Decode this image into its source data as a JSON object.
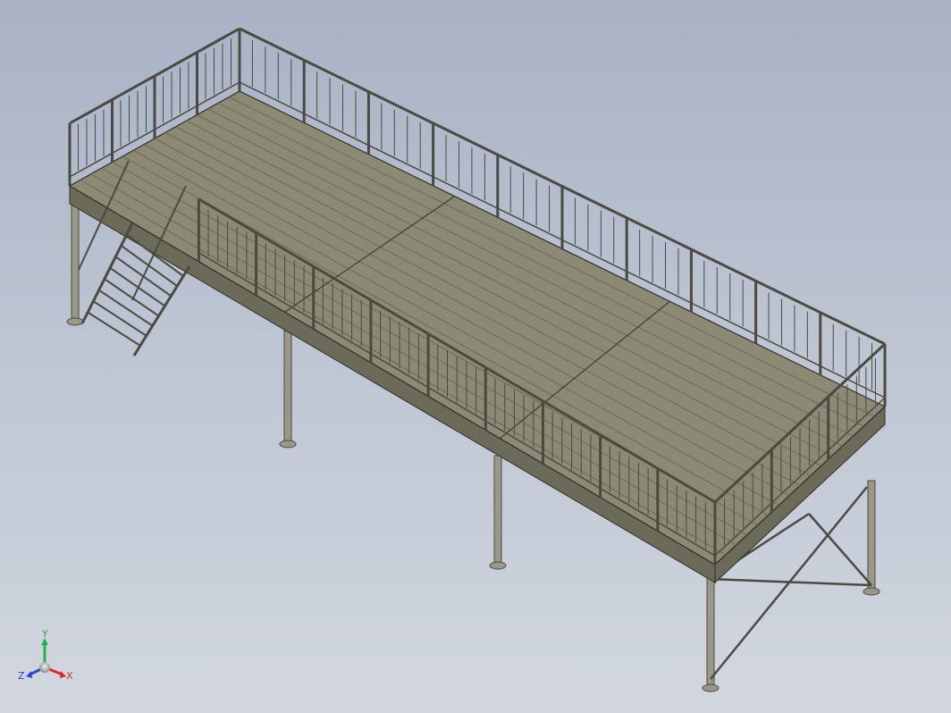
{
  "scene": {
    "model": "elevated-platform-with-stair",
    "colors": {
      "background_top": "#a9b2c5",
      "background_bottom": "#d2d7df",
      "deck": "#8c8a74",
      "deck_dark": "#6c6a58",
      "edge_line": "#2e2e28",
      "steel": "#9a9988",
      "steel_dark": "#4a4a40"
    }
  },
  "triad": {
    "x_label": "X",
    "y_label": "Y",
    "z_label": "Z",
    "x_color": "#e0262b",
    "y_color": "#22b04a",
    "z_color": "#2b48d8"
  }
}
